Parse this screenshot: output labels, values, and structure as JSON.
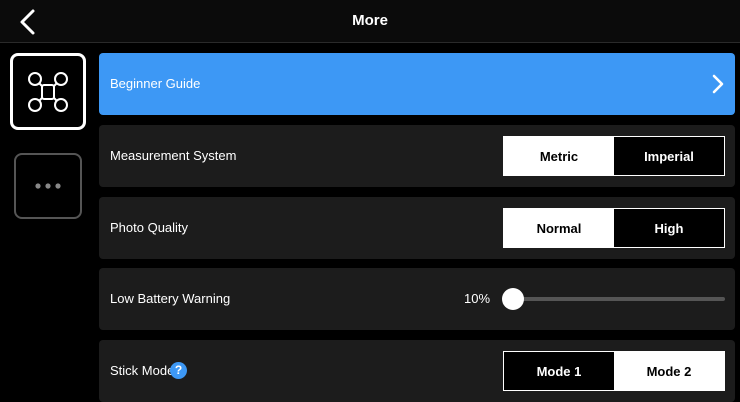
{
  "header": {
    "title": "More",
    "back_icon": "chevron-left-icon"
  },
  "sidebar": {
    "items": [
      {
        "icon": "drone-icon",
        "selected": true
      },
      {
        "icon": "more-dots-icon",
        "selected": false
      }
    ]
  },
  "settings": {
    "beginner_guide": {
      "label": "Beginner Guide",
      "icon": "chevron-right-icon"
    },
    "measurement": {
      "label": "Measurement System",
      "options": [
        "Metric",
        "Imperial"
      ],
      "selected": "Metric"
    },
    "photo_quality": {
      "label": "Photo Quality",
      "options": [
        "Normal",
        "High"
      ],
      "selected": "Normal"
    },
    "low_battery": {
      "label": "Low Battery Warning",
      "value_text": "10%",
      "slider_fraction": 0.0
    },
    "stick_mode": {
      "label": "Stick Mode",
      "help": "?",
      "options": [
        "Mode 1",
        "Mode 2"
      ],
      "selected": "Mode 2"
    }
  },
  "colors": {
    "accent": "#3d98f5",
    "row_bg": "#1c1c1c",
    "background": "#000000"
  }
}
